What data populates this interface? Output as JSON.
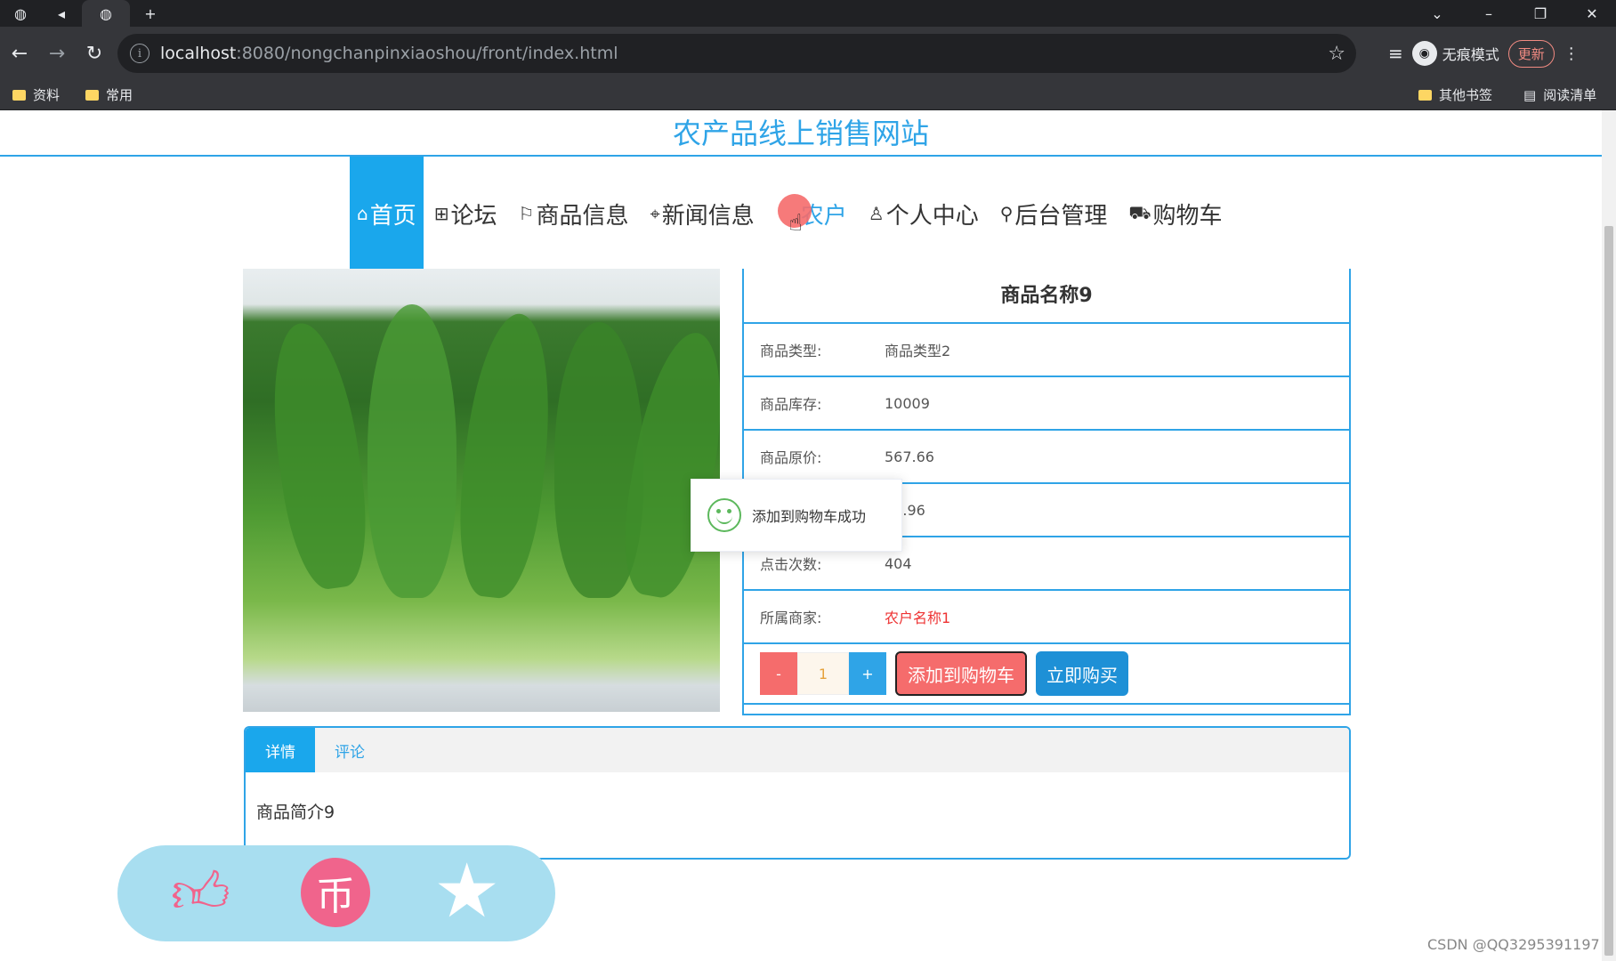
{
  "browser": {
    "url_host": "localhost",
    "url_rest": ":8080/nongchanpinxiaoshou/front/index.html",
    "incognito_label": "无痕模式",
    "update_label": "更新",
    "bookmarks": [
      "资料",
      "常用"
    ],
    "bookmarks_right": [
      "其他书签",
      "阅读清单"
    ]
  },
  "site": {
    "title": "农产品线上销售网站",
    "menu": [
      {
        "icon": "⌂",
        "label": "首页"
      },
      {
        "icon": "⊞",
        "label": "论坛"
      },
      {
        "icon": "⚐",
        "label": "商品信息"
      },
      {
        "icon": "⌖",
        "label": "新闻信息"
      },
      {
        "icon": "",
        "label": "农户"
      },
      {
        "icon": "♙",
        "label": "个人中心"
      },
      {
        "icon": "⚲",
        "label": "后台管理"
      },
      {
        "icon": "⛟",
        "label": "购物车"
      }
    ]
  },
  "product": {
    "name": "商品名称9",
    "fields": [
      {
        "label": "商品类型:",
        "value": "商品类型2"
      },
      {
        "label": "商品库存:",
        "value": "10009"
      },
      {
        "label": "商品原价:",
        "value": "567.66"
      },
      {
        "label": "",
        "value": "36.96"
      },
      {
        "label": "点击次数:",
        "value": "404"
      },
      {
        "label": "所属商家:",
        "value": "农户名称1"
      }
    ],
    "quantity": "1",
    "minus": "-",
    "plus": "+",
    "add_to_cart": "添加到购物车",
    "buy_now": "立即购买"
  },
  "toast": {
    "message": "添加到购物车成功"
  },
  "tabs": {
    "detail": "详情",
    "comment": "评论",
    "content": "商品简介9"
  },
  "watermark": "CSDN @QQ3295391197"
}
